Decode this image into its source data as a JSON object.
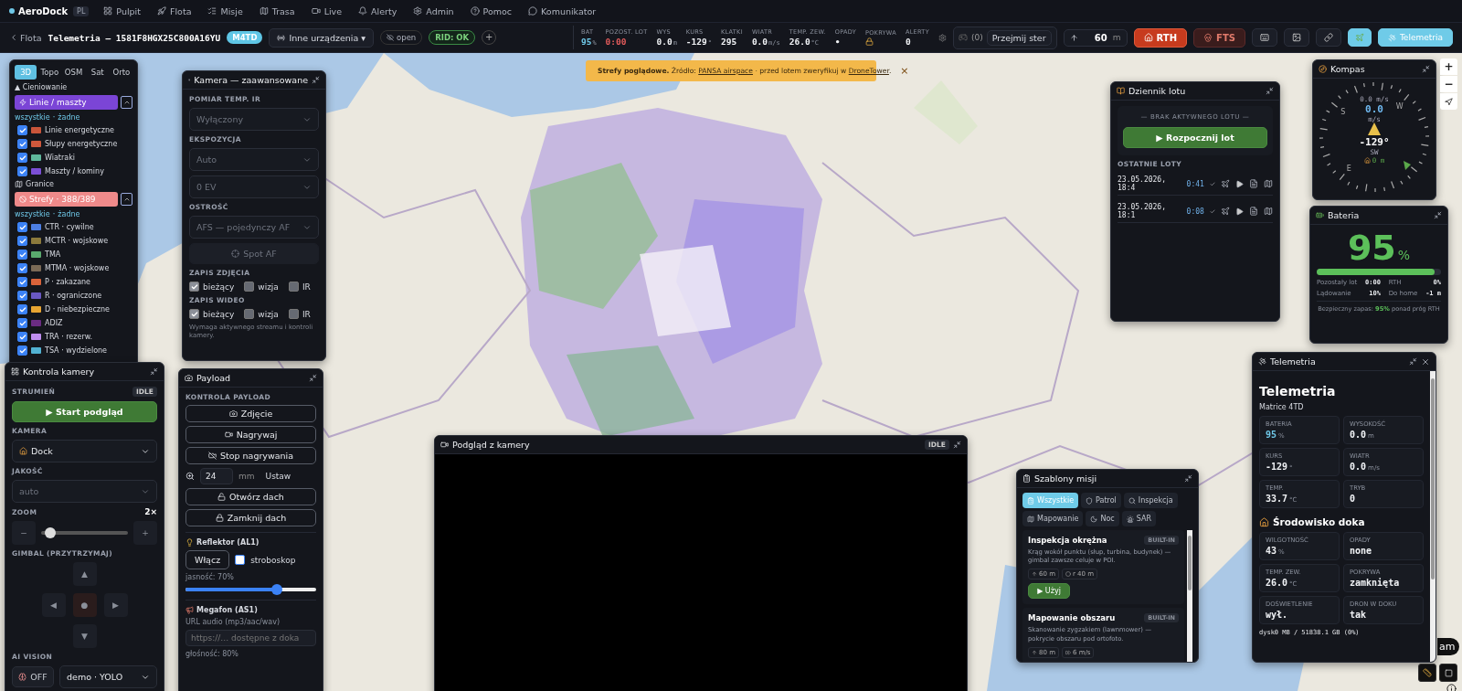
{
  "nav": {
    "brand": "AeroDock",
    "lang": "PL",
    "items": [
      {
        "label": "Pulpit"
      },
      {
        "label": "Flota"
      },
      {
        "label": "Misje"
      },
      {
        "label": "Trasa"
      },
      {
        "label": "Live"
      },
      {
        "label": "Alerty"
      },
      {
        "label": "Admin"
      },
      {
        "label": "Pomoc"
      },
      {
        "label": "Komunikator"
      }
    ]
  },
  "header": {
    "back": "Flota",
    "title": "Telemetria — 1581F8HGX25C800A16YU",
    "model": "M4TD",
    "device_menu": "Inne urządzenia ▾",
    "open_tag": "open",
    "rid": "RID: OK",
    "add": "+",
    "stats": [
      {
        "kind": "text",
        "label": "BAT",
        "value": "95",
        "unit": "%",
        "color": "#6fc8e8"
      },
      {
        "kind": "text",
        "label": "POZOST. LOT",
        "value": "0:00",
        "color": "#e25b5b"
      },
      {
        "kind": "text",
        "label": "WYS",
        "value": "0.0",
        "unit": "m",
        "color": "#f0f2f5"
      },
      {
        "kind": "text",
        "label": "KURS",
        "value": "-129",
        "unit": "°",
        "color": "#f0f2f5"
      },
      {
        "kind": "text",
        "label": "KLATKI",
        "value": "295",
        "color": "#f0f2f5"
      },
      {
        "kind": "text",
        "label": "WIATR",
        "value": "0.0",
        "unit": "m/s",
        "color": "#f0f2f5"
      },
      {
        "kind": "text",
        "label": "TEMP. ZEW.",
        "value": "26.0",
        "unit": "°C",
        "color": "#f0f2f5"
      },
      {
        "kind": "text",
        "label": "OPADY",
        "value": "•",
        "color": "#f0f2f5"
      },
      {
        "kind": "lock",
        "label": "POKRYWA"
      },
      {
        "kind": "text",
        "label": "ALERTY",
        "value": "0",
        "color": "#f0f2f5"
      }
    ],
    "gamepad_count": "(0)",
    "take_control": "Przejmij ster",
    "altitude": "60",
    "altitude_unit": "m",
    "rth": "RTH",
    "fts": "FTS",
    "telemetry": "Telemetria"
  },
  "banner": {
    "lead": "Strefy poglądowe.",
    "text_1": "Źródło:",
    "link_1": "PANSA airspace",
    "text_2": "· przed lotem zweryfikuj w",
    "link_2": "DroneTower",
    "text_3": ".",
    "close": "×"
  },
  "layers": {
    "tabs": [
      {
        "label": "3D",
        "selected": true
      },
      {
        "label": "Topo",
        "selected": false
      },
      {
        "label": "OSM",
        "selected": false
      },
      {
        "label": "Sat",
        "selected": false
      },
      {
        "label": "Orto",
        "selected": false
      }
    ],
    "shading": "▲ Cieniowanie",
    "groups": [
      {
        "kind": "lines",
        "label": "Linie / maszty",
        "expanded": true,
        "all": "wszystkie",
        "separator": "·",
        "none": "żadne",
        "items": [
          {
            "label": "Linie energetyczne",
            "checked": true,
            "color": "#c9553a"
          },
          {
            "label": "Słupy energetyczne",
            "checked": true,
            "color": "#d0583c"
          },
          {
            "label": "Wiatraki",
            "checked": true,
            "color": "#5fb89c"
          },
          {
            "label": "Maszty / kominy",
            "checked": true,
            "color": "#7b4fd6"
          }
        ]
      },
      {
        "kind": "borders",
        "label": "Granice"
      },
      {
        "kind": "zones",
        "label": "Strefy · 388/389",
        "expanded": true,
        "all": "wszystkie",
        "separator": "·",
        "none": "żadne",
        "items": [
          {
            "label": "CTR · cywilne",
            "checked": true,
            "color": "#4d7fe3"
          },
          {
            "label": "MCTR · wojskowe",
            "checked": true,
            "color": "#8c7a3c"
          },
          {
            "label": "TMA",
            "checked": true,
            "color": "#5aa96e"
          },
          {
            "label": "MTMA · wojskowe",
            "checked": true,
            "color": "#7a6a56"
          },
          {
            "label": "P · zakazane",
            "checked": true,
            "color": "#d9633a"
          },
          {
            "label": "R · ograniczone",
            "checked": true,
            "color": "#6a58c2"
          },
          {
            "label": "D · niebezpieczne",
            "checked": true,
            "color": "#e8a532"
          },
          {
            "label": "ADIZ",
            "checked": true,
            "color": "#6b2c82"
          },
          {
            "label": "TRA · rezerw.",
            "checked": true,
            "color": "#c08ef0"
          },
          {
            "label": "TSA · wydzielone",
            "checked": true,
            "color": "#52b2d2"
          }
        ]
      }
    ]
  },
  "camera_advanced": {
    "title": "Kamera — zaawansowane",
    "ir_label": "POMIAR TEMP. IR",
    "ir_select": {
      "value": "Wyłączony",
      "disabled": true
    },
    "exposure_label": "EKSPOZYCJA",
    "exposure_select": {
      "value": "Auto",
      "disabled": true
    },
    "ev_select": {
      "value": "0 EV",
      "disabled": true
    },
    "focus_label": "OSTROŚĆ",
    "focus_select": {
      "value": "AFS — pojedynczy AF",
      "disabled": true
    },
    "spot_af": "Spot AF",
    "photo_label": "ZAPIS ZDJĘCIA",
    "photo": [
      {
        "label": "bieżący",
        "checked": true
      },
      {
        "label": "wizja",
        "checked": false
      },
      {
        "label": "IR",
        "checked": false
      }
    ],
    "video_label": "ZAPIS WIDEO",
    "video": [
      {
        "label": "bieżący",
        "checked": true
      },
      {
        "label": "wizja",
        "checked": false
      },
      {
        "label": "IR",
        "checked": false
      }
    ],
    "note": "Wymaga aktywnego streamu i kontroli kamery."
  },
  "camera_control": {
    "title": "Kontrola kamery",
    "stream_label": "STRUMIEŃ",
    "stream_state": "IDLE",
    "start": "▶ Start podgląd",
    "camera_label": "KAMERA",
    "camera_select": {
      "value": "Dock",
      "disabled": false
    },
    "quality_label": "JAKOŚĆ",
    "quality_select": {
      "value": "auto",
      "disabled": true
    },
    "zoom_label": "ZOOM",
    "zoom_value": "2×",
    "zoom_minus": "−",
    "zoom_plus": "+",
    "zoom": {
      "level": 0.1
    },
    "gimbal_label": "GIMBAL (PRZYTRZYMAJ)",
    "gimbal": {
      "up": "▲",
      "left": "◀",
      "center": "●",
      "right": "▶",
      "down": "▼"
    },
    "ai_label": "AI VISION",
    "ai_toggle": "OFF",
    "ai_select": {
      "value": "demo · YOLO",
      "disabled": false
    }
  },
  "payload": {
    "title": "Payload",
    "section": "KONTROLA PAYLOAD",
    "buttons": [
      {
        "label": "Zdjęcie"
      },
      {
        "kind": "record",
        "label": "Nagrywaj"
      },
      {
        "kind": "stop",
        "label": "Stop nagrywania"
      }
    ],
    "focal": "24",
    "focal_unit": "mm",
    "set": "Ustaw",
    "roof": [
      {
        "kind": "open",
        "label": "Otwórz dach"
      },
      {
        "kind": "close",
        "label": "Zamknij dach"
      }
    ],
    "light_title": "Reflektor (AL1)",
    "light_button": "Włącz",
    "strobe": {
      "label": "stroboskop",
      "checked": false
    },
    "brightness_label": "jasność: 70%",
    "brightness": {
      "level": 0.7
    },
    "megaphone_title": "Megafon (AS1)",
    "audio_label": "URL audio (mp3/aac/wav)",
    "audio_placeholder": "https://… dostępne z doka",
    "volume_label": "głośność: 80%"
  },
  "preview": {
    "title": "Podgląd z kamery",
    "state": "IDLE"
  },
  "flight_log": {
    "title": "Dziennik lotu",
    "no_flight": "— BRAK AKTYWNEGO LOTU —",
    "start": "▶ Rozpocznij lot",
    "recent_label": "OSTATNIE LOTY",
    "flights": [
      {
        "date": "23.05.2026, 18:4",
        "duration": "0:41"
      },
      {
        "date": "23.05.2026, 18:1",
        "duration": "0:08"
      }
    ]
  },
  "compass": {
    "title": "Kompas",
    "speed_small": "0.0 m/s",
    "speed": "0.0",
    "speed_unit": "m/s",
    "heading": "-129°",
    "direction": "SW",
    "home": "0 m",
    "dial_labels": [
      "S",
      "W",
      "E"
    ]
  },
  "battery": {
    "title": "Bateria",
    "value": "95",
    "unit": "%",
    "level": 0.95,
    "remaining_label": "Pozostały lot",
    "remaining": "0:00",
    "rth_label": "RTH",
    "rth": "0%",
    "landing_label": "Lądowanie",
    "landing": "10%",
    "home_label": "Do home",
    "home": "-1 m",
    "footer": "Bezpieczny zapas: **95%** ponad próg RTH"
  },
  "telemetry": {
    "title": "Telemetria",
    "heading": "Telemetria",
    "model": "Matrice 4TD",
    "cards": [
      {
        "label": "BATERIA",
        "value": "95",
        "unit": "%",
        "color": "#6fc8e8"
      },
      {
        "label": "WYSOKOŚĆ",
        "value": "0.0",
        "unit": "m",
        "color": "#f0f2f5"
      },
      {
        "label": "KURS",
        "value": "-129",
        "unit": "°",
        "color": "#f0f2f5"
      },
      {
        "label": "WIATR",
        "value": "0.0",
        "unit": "m/s",
        "color": "#f0f2f5"
      },
      {
        "label": "TEMP.",
        "value": "33.7",
        "unit": "°C",
        "color": "#f0f2f5"
      },
      {
        "label": "TRYB",
        "value": "0",
        "color": "#f0f2f5"
      }
    ],
    "dock_heading": "Środowisko doka",
    "dock_cards": [
      {
        "label": "WILGOTNOŚĆ",
        "value": "43",
        "unit": "%",
        "color": "#f0f2f5"
      },
      {
        "label": "OPADY",
        "value": "none",
        "color": "#f0f2f5"
      },
      {
        "label": "TEMP. ZEW.",
        "value": "26.0",
        "unit": "°C",
        "color": "#f0f2f5"
      },
      {
        "label": "POKRYWA",
        "value": "zamknięta",
        "color": "#f0f2f5"
      },
      {
        "label": "DOŚWIETLENIE",
        "value": "wył.",
        "color": "#f0f2f5"
      },
      {
        "label": "DRON W DOKU",
        "value": "tak",
        "color": "#f0f2f5"
      }
    ],
    "disk": "dysk0 MB / 51838.1 GB (0%)"
  },
  "templates": {
    "title": "Szablony misji",
    "filters": [
      {
        "label": "Wszystkie",
        "selected": true
      },
      {
        "label": "Patrol",
        "selected": false
      },
      {
        "label": "Inspekcja",
        "selected": false
      },
      {
        "label": "Mapowanie",
        "selected": false
      },
      {
        "label": "Noc",
        "selected": false
      },
      {
        "label": "SAR",
        "selected": false
      }
    ],
    "items": [
      {
        "title": "Inspekcja okrężna",
        "badge": "BUILT-IN",
        "description": "Krąg wokół punktu (słup, turbina, budynek) — gimbal zawsze celuje w POI.",
        "tags": [
          {
            "kind": "altitude",
            "label": "60 m"
          },
          {
            "kind": "radius",
            "label": "r 40 m"
          }
        ],
        "use": "▶ Użyj"
      },
      {
        "title": "Mapowanie obszaru",
        "badge": "BUILT-IN",
        "description": "Skanowanie zygzakiem (lawnmower) — pokrycie obszaru pod ortofoto.",
        "tags": [
          {
            "kind": "altitude",
            "label": "80 m"
          },
          {
            "kind": "speed",
            "label": "6 m/s"
          }
        ]
      }
    ]
  },
  "map_controls": {
    "zoom_in": "+",
    "zoom_out": "−",
    "partial_button": "am"
  }
}
